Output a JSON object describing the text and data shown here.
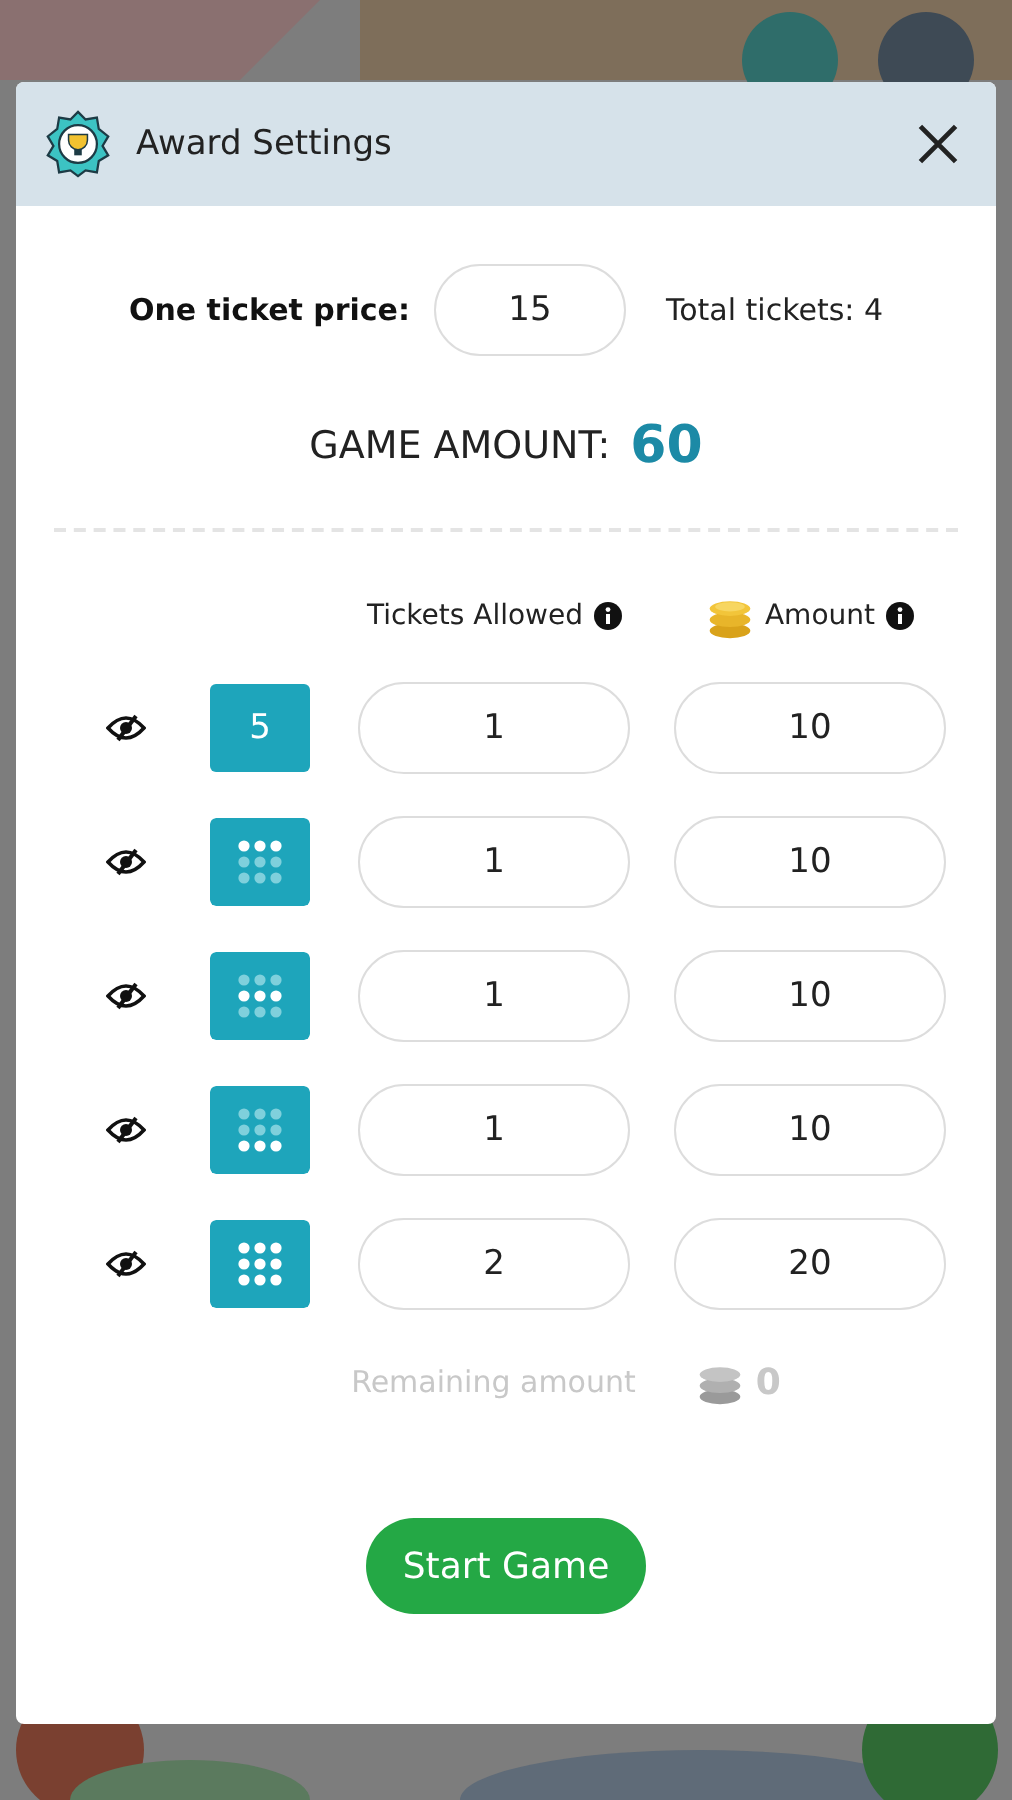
{
  "dialog": {
    "title": "Award Settings"
  },
  "price": {
    "label": "One ticket price:",
    "value": "15",
    "total": "Total tickets: 4"
  },
  "game_amount": {
    "label": "GAME AMOUNT:",
    "value": "60"
  },
  "columns": [
    "Tickets Allowed",
    "Amount"
  ],
  "rows": [
    {
      "visible": true,
      "pattern": {
        "kind": "number",
        "label": "5"
      },
      "tickets": "1",
      "amount": "10"
    },
    {
      "visible": true,
      "pattern": {
        "kind": "rows",
        "lit_rows": [
          true,
          false,
          false
        ]
      },
      "tickets": "1",
      "amount": "10"
    },
    {
      "visible": true,
      "pattern": {
        "kind": "rows",
        "lit_rows": [
          false,
          true,
          false
        ]
      },
      "tickets": "1",
      "amount": "10"
    },
    {
      "visible": true,
      "pattern": {
        "kind": "rows",
        "lit_rows": [
          false,
          false,
          true
        ]
      },
      "tickets": "1",
      "amount": "10"
    },
    {
      "visible": true,
      "pattern": {
        "kind": "rows",
        "lit_rows": [
          true,
          true,
          true
        ]
      },
      "tickets": "2",
      "amount": "20"
    }
  ],
  "remaining": {
    "label": "Remaining amount",
    "value": "0"
  },
  "start_button": "Start Game"
}
